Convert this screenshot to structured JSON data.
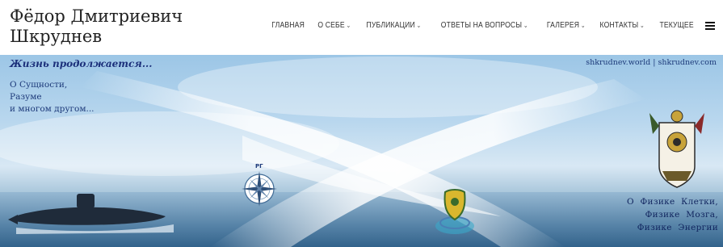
{
  "site": {
    "title_line1": "Фёдор Дмитриевич",
    "title_line2": "Шкруднев"
  },
  "nav": {
    "items": [
      {
        "label": "ГЛАВНАЯ",
        "dropdown": false
      },
      {
        "label": "О СЕБЕ",
        "dropdown": true
      },
      {
        "label": "ПУБЛИКАЦИИ",
        "dropdown": true
      },
      {
        "label": "ОТВЕТЫ НА ВОПРОСЫ",
        "dropdown": true
      },
      {
        "label": "ГАЛЕРЕЯ",
        "dropdown": true
      },
      {
        "label": "КОНТАКТЫ",
        "dropdown": true
      },
      {
        "label": "ТЕКУЩЕЕ",
        "dropdown": false
      }
    ],
    "menu_icon": "hamburger-icon"
  },
  "banner": {
    "tagline": "Жизнь продолжается...",
    "left_lines": [
      "О Сущности,",
      "Разуме",
      "и многом другом..."
    ],
    "domains": "shkrudnev.world | shkrudnev.com",
    "right_lines": [
      "О Физике Клетки,",
      "Физике Мозга,",
      "Физике Энергии"
    ],
    "compass_label": "РГ",
    "icons": [
      "submarine-image",
      "compass-emblem",
      "shield-emblem",
      "coat-of-arms-emblem"
    ]
  },
  "colors": {
    "accent_text": "#1b2f7a",
    "sky": "#9cc6e6",
    "sea": "#3f6f96"
  }
}
